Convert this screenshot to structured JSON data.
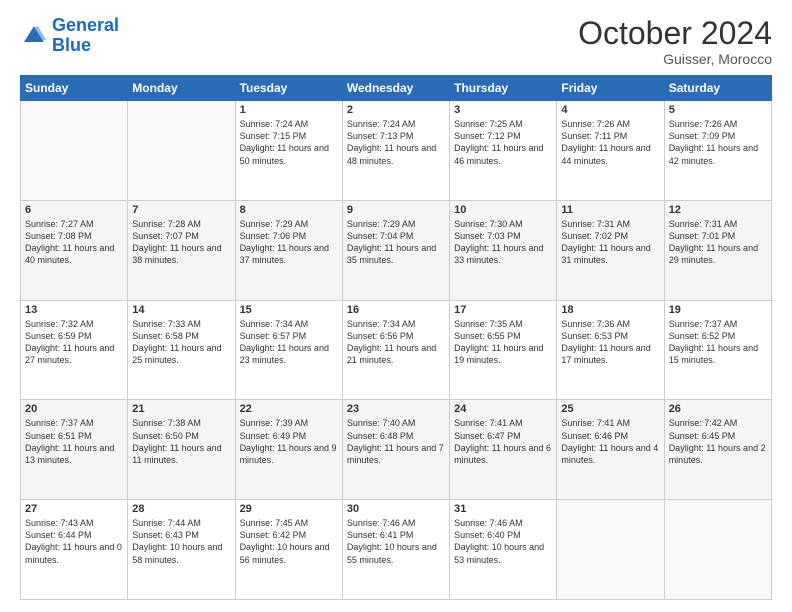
{
  "header": {
    "logo_general": "General",
    "logo_blue": "Blue",
    "month": "October 2024",
    "location": "Guisser, Morocco"
  },
  "days_of_week": [
    "Sunday",
    "Monday",
    "Tuesday",
    "Wednesday",
    "Thursday",
    "Friday",
    "Saturday"
  ],
  "weeks": [
    [
      {
        "day": "",
        "sunrise": "",
        "sunset": "",
        "daylight": ""
      },
      {
        "day": "",
        "sunrise": "",
        "sunset": "",
        "daylight": ""
      },
      {
        "day": "1",
        "sunrise": "Sunrise: 7:24 AM",
        "sunset": "Sunset: 7:15 PM",
        "daylight": "Daylight: 11 hours and 50 minutes."
      },
      {
        "day": "2",
        "sunrise": "Sunrise: 7:24 AM",
        "sunset": "Sunset: 7:13 PM",
        "daylight": "Daylight: 11 hours and 48 minutes."
      },
      {
        "day": "3",
        "sunrise": "Sunrise: 7:25 AM",
        "sunset": "Sunset: 7:12 PM",
        "daylight": "Daylight: 11 hours and 46 minutes."
      },
      {
        "day": "4",
        "sunrise": "Sunrise: 7:26 AM",
        "sunset": "Sunset: 7:11 PM",
        "daylight": "Daylight: 11 hours and 44 minutes."
      },
      {
        "day": "5",
        "sunrise": "Sunrise: 7:26 AM",
        "sunset": "Sunset: 7:09 PM",
        "daylight": "Daylight: 11 hours and 42 minutes."
      }
    ],
    [
      {
        "day": "6",
        "sunrise": "Sunrise: 7:27 AM",
        "sunset": "Sunset: 7:08 PM",
        "daylight": "Daylight: 11 hours and 40 minutes."
      },
      {
        "day": "7",
        "sunrise": "Sunrise: 7:28 AM",
        "sunset": "Sunset: 7:07 PM",
        "daylight": "Daylight: 11 hours and 38 minutes."
      },
      {
        "day": "8",
        "sunrise": "Sunrise: 7:29 AM",
        "sunset": "Sunset: 7:06 PM",
        "daylight": "Daylight: 11 hours and 37 minutes."
      },
      {
        "day": "9",
        "sunrise": "Sunrise: 7:29 AM",
        "sunset": "Sunset: 7:04 PM",
        "daylight": "Daylight: 11 hours and 35 minutes."
      },
      {
        "day": "10",
        "sunrise": "Sunrise: 7:30 AM",
        "sunset": "Sunset: 7:03 PM",
        "daylight": "Daylight: 11 hours and 33 minutes."
      },
      {
        "day": "11",
        "sunrise": "Sunrise: 7:31 AM",
        "sunset": "Sunset: 7:02 PM",
        "daylight": "Daylight: 11 hours and 31 minutes."
      },
      {
        "day": "12",
        "sunrise": "Sunrise: 7:31 AM",
        "sunset": "Sunset: 7:01 PM",
        "daylight": "Daylight: 11 hours and 29 minutes."
      }
    ],
    [
      {
        "day": "13",
        "sunrise": "Sunrise: 7:32 AM",
        "sunset": "Sunset: 6:59 PM",
        "daylight": "Daylight: 11 hours and 27 minutes."
      },
      {
        "day": "14",
        "sunrise": "Sunrise: 7:33 AM",
        "sunset": "Sunset: 6:58 PM",
        "daylight": "Daylight: 11 hours and 25 minutes."
      },
      {
        "day": "15",
        "sunrise": "Sunrise: 7:34 AM",
        "sunset": "Sunset: 6:57 PM",
        "daylight": "Daylight: 11 hours and 23 minutes."
      },
      {
        "day": "16",
        "sunrise": "Sunrise: 7:34 AM",
        "sunset": "Sunset: 6:56 PM",
        "daylight": "Daylight: 11 hours and 21 minutes."
      },
      {
        "day": "17",
        "sunrise": "Sunrise: 7:35 AM",
        "sunset": "Sunset: 6:55 PM",
        "daylight": "Daylight: 11 hours and 19 minutes."
      },
      {
        "day": "18",
        "sunrise": "Sunrise: 7:36 AM",
        "sunset": "Sunset: 6:53 PM",
        "daylight": "Daylight: 11 hours and 17 minutes."
      },
      {
        "day": "19",
        "sunrise": "Sunrise: 7:37 AM",
        "sunset": "Sunset: 6:52 PM",
        "daylight": "Daylight: 11 hours and 15 minutes."
      }
    ],
    [
      {
        "day": "20",
        "sunrise": "Sunrise: 7:37 AM",
        "sunset": "Sunset: 6:51 PM",
        "daylight": "Daylight: 11 hours and 13 minutes."
      },
      {
        "day": "21",
        "sunrise": "Sunrise: 7:38 AM",
        "sunset": "Sunset: 6:50 PM",
        "daylight": "Daylight: 11 hours and 11 minutes."
      },
      {
        "day": "22",
        "sunrise": "Sunrise: 7:39 AM",
        "sunset": "Sunset: 6:49 PM",
        "daylight": "Daylight: 11 hours and 9 minutes."
      },
      {
        "day": "23",
        "sunrise": "Sunrise: 7:40 AM",
        "sunset": "Sunset: 6:48 PM",
        "daylight": "Daylight: 11 hours and 7 minutes."
      },
      {
        "day": "24",
        "sunrise": "Sunrise: 7:41 AM",
        "sunset": "Sunset: 6:47 PM",
        "daylight": "Daylight: 11 hours and 6 minutes."
      },
      {
        "day": "25",
        "sunrise": "Sunrise: 7:41 AM",
        "sunset": "Sunset: 6:46 PM",
        "daylight": "Daylight: 11 hours and 4 minutes."
      },
      {
        "day": "26",
        "sunrise": "Sunrise: 7:42 AM",
        "sunset": "Sunset: 6:45 PM",
        "daylight": "Daylight: 11 hours and 2 minutes."
      }
    ],
    [
      {
        "day": "27",
        "sunrise": "Sunrise: 7:43 AM",
        "sunset": "Sunset: 6:44 PM",
        "daylight": "Daylight: 11 hours and 0 minutes."
      },
      {
        "day": "28",
        "sunrise": "Sunrise: 7:44 AM",
        "sunset": "Sunset: 6:43 PM",
        "daylight": "Daylight: 10 hours and 58 minutes."
      },
      {
        "day": "29",
        "sunrise": "Sunrise: 7:45 AM",
        "sunset": "Sunset: 6:42 PM",
        "daylight": "Daylight: 10 hours and 56 minutes."
      },
      {
        "day": "30",
        "sunrise": "Sunrise: 7:46 AM",
        "sunset": "Sunset: 6:41 PM",
        "daylight": "Daylight: 10 hours and 55 minutes."
      },
      {
        "day": "31",
        "sunrise": "Sunrise: 7:46 AM",
        "sunset": "Sunset: 6:40 PM",
        "daylight": "Daylight: 10 hours and 53 minutes."
      },
      {
        "day": "",
        "sunrise": "",
        "sunset": "",
        "daylight": ""
      },
      {
        "day": "",
        "sunrise": "",
        "sunset": "",
        "daylight": ""
      }
    ]
  ]
}
